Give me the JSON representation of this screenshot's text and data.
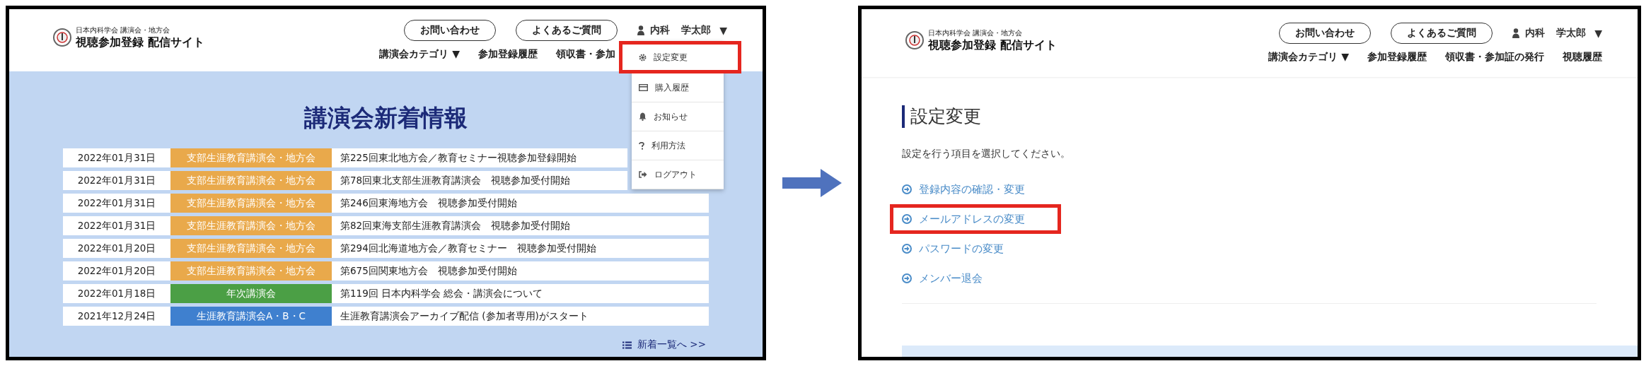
{
  "before_screen": {
    "header": {
      "org": "日本内科学会 講演会・地方会",
      "site": "視聴参加登録 配信サイト",
      "buttons": [
        "お問い合わせ",
        "よくあるご質問"
      ],
      "user": {
        "surname": "内科",
        "given": "学太郎",
        "caret": "▼"
      },
      "nav": [
        {
          "label": "講演会カテゴリ",
          "caret": "▼"
        },
        {
          "label": "参加登録履歴"
        },
        {
          "label": "領収書・参加"
        }
      ]
    },
    "title": "講演会新着情報",
    "news": [
      {
        "date": "2022年01月31日",
        "category": "支部生涯教育講演会・地方会",
        "color": "#e9a94b",
        "title": "第225回東北地方会／教育セミナー視聴参加登録開始"
      },
      {
        "date": "2022年01月31日",
        "category": "支部生涯教育講演会・地方会",
        "color": "#e9a94b",
        "title": "第78回東北支部生涯教育講演会　視聴参加受付開始"
      },
      {
        "date": "2022年01月31日",
        "category": "支部生涯教育講演会・地方会",
        "color": "#e9a94b",
        "title": "第246回東海地方会　視聴参加受付開始"
      },
      {
        "date": "2022年01月31日",
        "category": "支部生涯教育講演会・地方会",
        "color": "#e9a94b",
        "title": "第82回東海支部生涯教育講演会　視聴参加受付開始"
      },
      {
        "date": "2022年01月20日",
        "category": "支部生涯教育講演会・地方会",
        "color": "#e9a94b",
        "title": "第294回北海道地方会／教育セミナー　視聴参加受付開始"
      },
      {
        "date": "2022年01月20日",
        "category": "支部生涯教育講演会・地方会",
        "color": "#e9a94b",
        "title": "第675回関東地方会　視聴参加受付開始"
      },
      {
        "date": "2022年01月18日",
        "category": "年次講演会",
        "color": "#4b9f45",
        "title": "第119回 日本内科学会 総会・講演会について"
      },
      {
        "date": "2021年12月24日",
        "category": "生涯教育講演会A・B・C",
        "color": "#3f80cf",
        "title": "生涯教育講演会アーカイブ配信 (参加者専用)がスタート"
      }
    ],
    "more_link": "新着一覧へ >>",
    "menu": [
      {
        "label": "設定変更",
        "highlighted": true
      },
      {
        "label": "購入履歴",
        "highlighted": false
      },
      {
        "label": "お知らせ",
        "highlighted": false
      },
      {
        "label": "利用方法",
        "highlighted": false
      },
      {
        "label": "ログアウト",
        "highlighted": false
      }
    ]
  },
  "after_screen": {
    "header": {
      "org": "日本内科学会 講演会・地方会",
      "site": "視聴参加登録 配信サイト",
      "buttons": [
        "お問い合わせ",
        "よくあるご質問"
      ],
      "user": {
        "surname": "内科",
        "given": "学太郎",
        "caret": "▼"
      },
      "nav": [
        {
          "label": "講演会カテゴリ",
          "caret": "▼"
        },
        {
          "label": "参加登録履歴"
        },
        {
          "label": "領収書・参加証の発行"
        },
        {
          "label": "視聴履歴"
        }
      ]
    },
    "title": "設定変更",
    "instruction": "設定を行う項目を選択してください。",
    "links": [
      {
        "label": "登録内容の確認・変更",
        "highlighted": false
      },
      {
        "label": "メールアドレスの変更",
        "highlighted": true
      },
      {
        "label": "パスワードの変更",
        "highlighted": false
      },
      {
        "label": "メンバー退会",
        "highlighted": false
      }
    ]
  }
}
